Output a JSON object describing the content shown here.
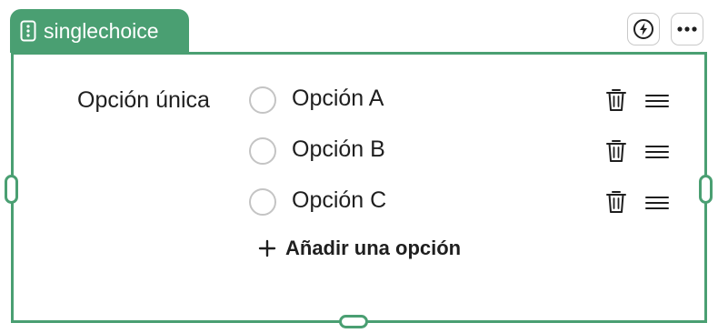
{
  "block": {
    "type_label": "singlechoice",
    "type_icon": "vertical-dots-form-icon",
    "question_label": "Opción única",
    "add_option_label": "Añadir una opción"
  },
  "toolbar": {
    "actions": [
      {
        "icon": "lightning-icon"
      },
      {
        "icon": "more-horizontal-icon"
      }
    ]
  },
  "options": [
    {
      "label": "Opción A",
      "selected": false
    },
    {
      "label": "Opción B",
      "selected": false
    },
    {
      "label": "Opción C",
      "selected": false
    }
  ],
  "colors": {
    "accent": "#4a9f72",
    "radio_border": "#c4c4c4",
    "text": "#1f1f1f"
  },
  "option_icons": [
    "trash-icon",
    "drag-handle-icon"
  ]
}
